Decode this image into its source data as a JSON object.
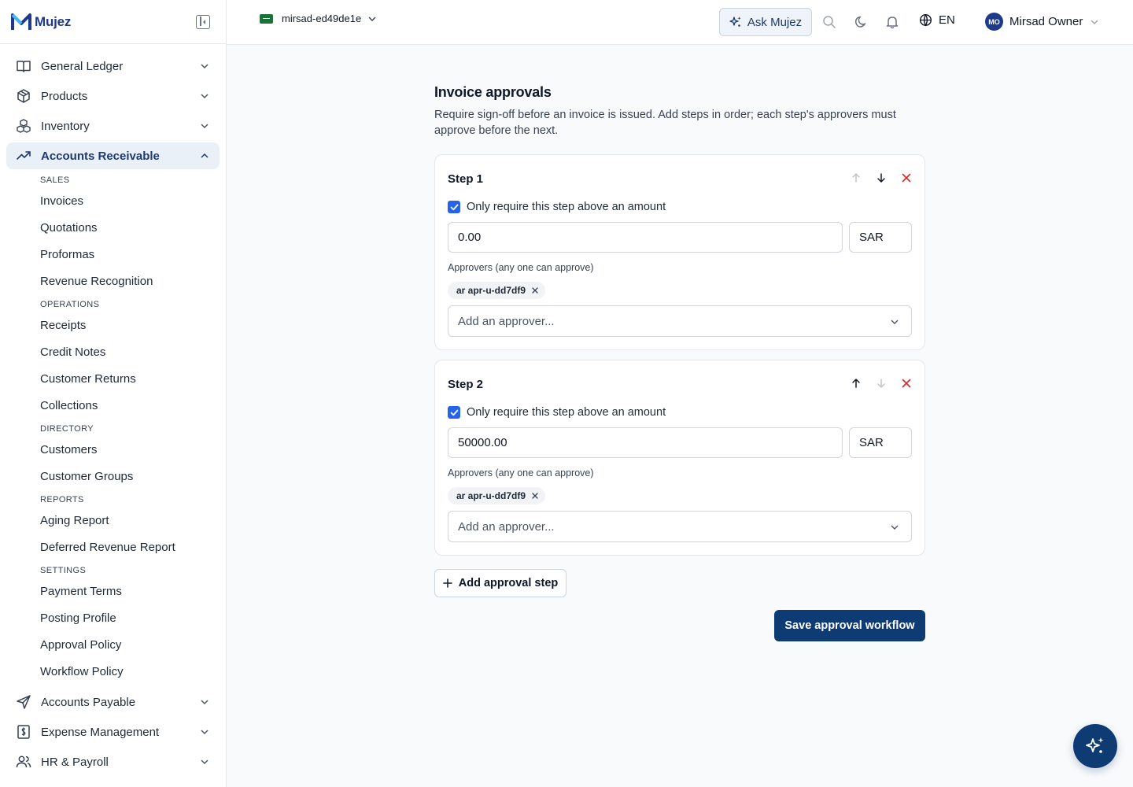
{
  "brand": {
    "name": "Mujez"
  },
  "sidebar": {
    "top_items": [
      {
        "label": "General Ledger"
      },
      {
        "label": "Products"
      },
      {
        "label": "Inventory"
      },
      {
        "label": "Accounts Receivable"
      }
    ],
    "ar_sections": [
      {
        "header": "SALES",
        "items": [
          "Invoices",
          "Quotations",
          "Proformas",
          "Revenue Recognition"
        ]
      },
      {
        "header": "OPERATIONS",
        "items": [
          "Receipts",
          "Credit Notes",
          "Customer Returns",
          "Collections"
        ]
      },
      {
        "header": "DIRECTORY",
        "items": [
          "Customers",
          "Customer Groups"
        ]
      },
      {
        "header": "REPORTS",
        "items": [
          "Aging Report",
          "Deferred Revenue Report"
        ]
      },
      {
        "header": "SETTINGS",
        "items": [
          "Payment Terms",
          "Posting Profile",
          "Approval Policy",
          "Workflow Policy"
        ]
      }
    ],
    "bottom_items": [
      {
        "label": "Accounts Payable"
      },
      {
        "label": "Expense Management"
      },
      {
        "label": "HR & Payroll"
      }
    ]
  },
  "topbar": {
    "org_name": "mirsad-ed49de1e",
    "ask_label": "Ask Mujez",
    "language": "EN",
    "user_initials": "MO",
    "user_name": "Mirsad Owner"
  },
  "page": {
    "title": "Invoice approvals",
    "description": "Require sign-off before an invoice is issued. Add steps in order; each step's approvers must approve before the next."
  },
  "steps": [
    {
      "title": "Step 1",
      "threshold_label": "Only require this step above an amount",
      "threshold_checked": true,
      "amount": "0.00",
      "currency": "SAR",
      "approvers_label": "Approvers (any one can approve)",
      "approver_chip": "ar apr-u-dd7df9",
      "approver_placeholder": "Add an approver..."
    },
    {
      "title": "Step 2",
      "threshold_label": "Only require this step above an amount",
      "threshold_checked": true,
      "amount": "50000.00",
      "currency": "SAR",
      "approvers_label": "Approvers (any one can approve)",
      "approver_chip": "ar apr-u-dd7df9",
      "approver_placeholder": "Add an approver..."
    }
  ],
  "actions": {
    "add_step": "Add approval step",
    "save": "Save approval workflow"
  },
  "colors": {
    "primary": "#0f3b74",
    "accent": "#2563eb",
    "danger": "#dc2626",
    "active_nav_bg": "#eaf0f8"
  }
}
